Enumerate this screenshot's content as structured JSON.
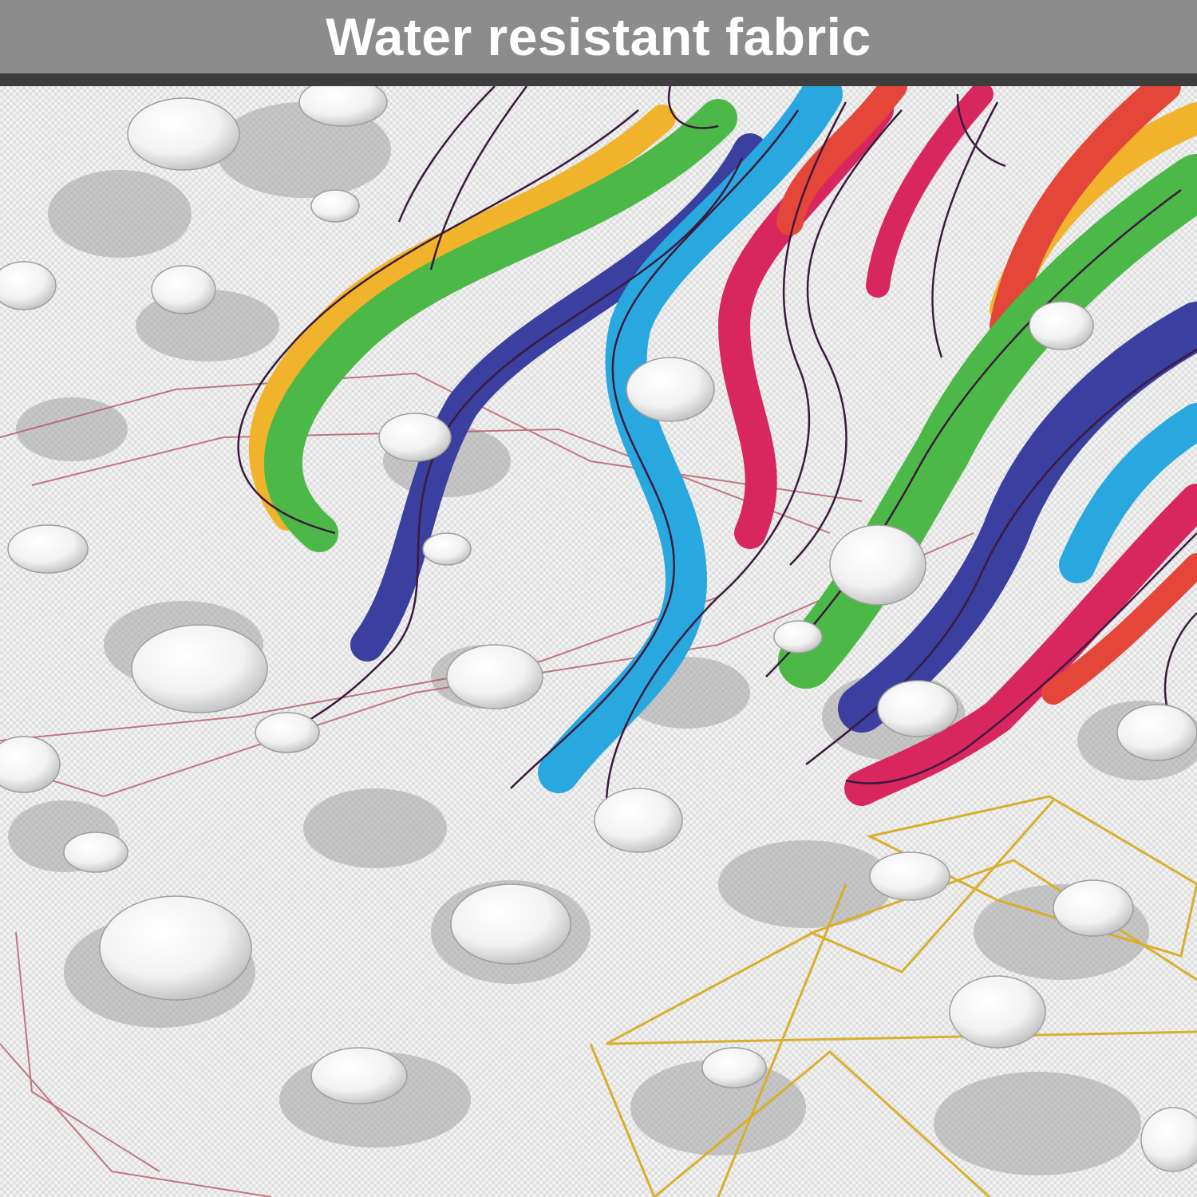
{
  "banner": {
    "title": "Water resistant fabric"
  },
  "photo": {
    "subject": "rainbow-hair-illustration-on-fabric-with-water-droplets",
    "colors": {
      "fabric": "#e8e8e8",
      "drop_shadow": "#9a9a9a",
      "hair": [
        "#f2b32c",
        "#4cb848",
        "#29a7df",
        "#d8265f",
        "#3b3f9f",
        "#e4463a"
      ],
      "outline": "#3b1a3d",
      "red_lines": "#b3505f",
      "gold_lines": "#d8b02c"
    }
  }
}
